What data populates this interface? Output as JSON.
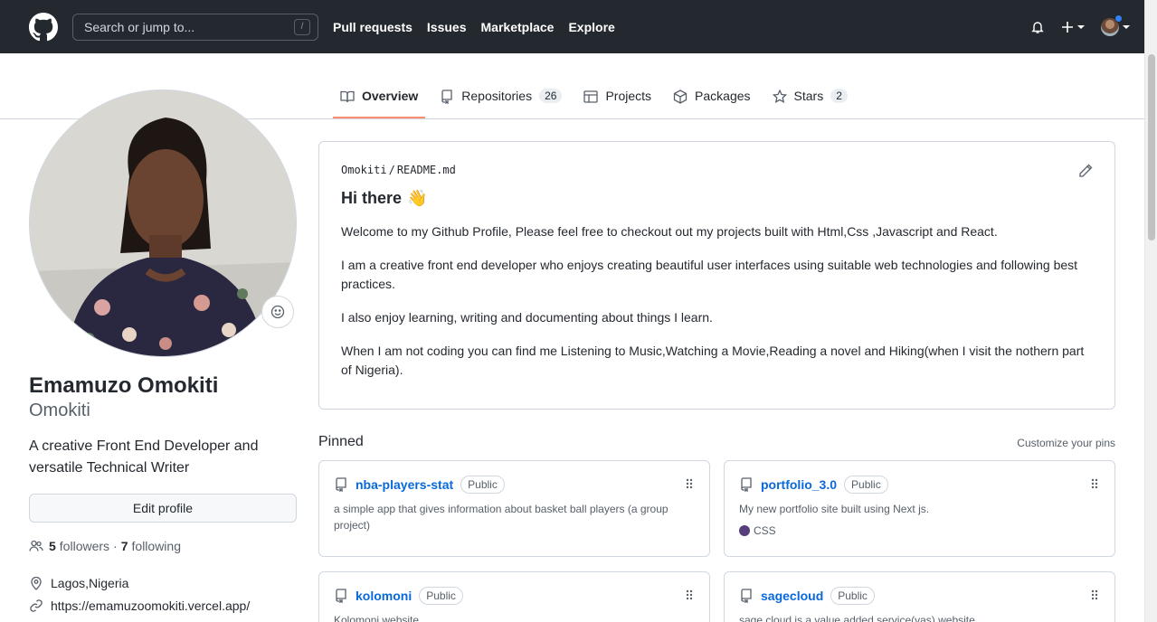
{
  "header": {
    "search_placeholder": "Search or jump to...",
    "search_shortcut": "/",
    "nav": [
      "Pull requests",
      "Issues",
      "Marketplace",
      "Explore"
    ]
  },
  "tabs": [
    {
      "label": "Overview",
      "icon": "book-icon"
    },
    {
      "label": "Repositories",
      "icon": "repo-icon",
      "count": "26"
    },
    {
      "label": "Projects",
      "icon": "table-icon"
    },
    {
      "label": "Packages",
      "icon": "package-icon"
    },
    {
      "label": "Stars",
      "icon": "star-icon",
      "count": "2"
    }
  ],
  "profile": {
    "name": "Emamuzo Omokiti",
    "login": "Omokiti",
    "bio": "A creative Front End Developer and versatile Technical Writer",
    "edit_label": "Edit profile",
    "followers_count": "5",
    "followers_label": "followers",
    "separator": "·",
    "following_count": "7",
    "following_label": "following",
    "location": "Lagos,Nigeria",
    "website": "https://emamuzoomokiti.vercel.app/"
  },
  "readme": {
    "owner": "Omokiti",
    "sep": "/",
    "file": "README.md",
    "heading": "Hi there",
    "heading_emoji": "👋",
    "paragraphs": [
      "Welcome to my Github Profile, Please feel free to checkout out my projects built with Html,Css ,Javascript and React.",
      "I am a creative front end developer who enjoys creating beautiful user interfaces using suitable web technologies and following best practices.",
      "I also enjoy learning, writing and documenting about things I learn.",
      "When I am not coding you can find me Listening to Music,Watching a Movie,Reading a novel and Hiking(when I visit the nothern part of Nigeria)."
    ]
  },
  "pinned": {
    "title": "Pinned",
    "customize": "Customize your pins",
    "repos": [
      {
        "name": "nba-players-stat",
        "visibility": "Public",
        "description": "a simple app that gives information about basket ball players (a group project)"
      },
      {
        "name": "portfolio_3.0",
        "visibility": "Public",
        "description": "My new portfolio site built using Next js.",
        "language": "CSS",
        "language_color": "#563d7c"
      },
      {
        "name": "kolomoni",
        "visibility": "Public",
        "description": "Kolomoni website"
      },
      {
        "name": "sagecloud",
        "visibility": "Public",
        "description": "sage cloud is a value added service(vas) website"
      }
    ]
  }
}
